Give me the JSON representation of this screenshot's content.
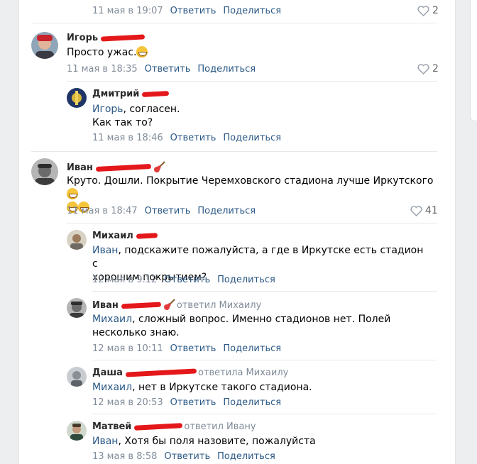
{
  "comments": [
    {
      "date": "11 мая в 19:07",
      "reply": "Ответить",
      "share": "Поделиться",
      "likes": "2"
    },
    {
      "name": "Игорь",
      "text": "Просто ужас.",
      "date": "11 мая в 18:35",
      "reply": "Ответить",
      "share": "Поделиться",
      "likes": "2"
    },
    {
      "name": "Дмитрий",
      "mention": "Игорь",
      "text1": ", согласен.",
      "text2": "Как так то?",
      "date": "11 мая в 18:46",
      "reply": "Ответить",
      "share": "Поделиться"
    },
    {
      "name": "Иван",
      "text": "Круто. Дошли. Покрытие Черемховского стадиона лучше Иркутского",
      "date": "11 мая в 18:47",
      "reply": "Ответить",
      "share": "Поделиться",
      "likes": "41"
    },
    {
      "name": "Михаил",
      "mention": "Иван",
      "text1": ", подскажите пожалуйста, а где в Иркутске есть стадион с",
      "text2": "хорошим покрытием?",
      "date": "12 мая в 9:12",
      "reply": "Ответить",
      "share": "Поделиться"
    },
    {
      "name": "Иван",
      "reply_to": "ответил Михаилу",
      "mention": "Михаил",
      "text1": ", сложный вопрос. Именно стадионов нет. Полей",
      "text2": "несколько знаю.",
      "date": "12 мая в 10:11",
      "reply": "Ответить",
      "share": "Поделиться"
    },
    {
      "name": "Даша",
      "reply_to": "ответила Михаилу",
      "mention": "Михаил",
      "text1": ", нет в Иркутске такого стадиона.",
      "date": "12 мая в 20:53",
      "reply": "Ответить",
      "share": "Поделиться"
    },
    {
      "name": "Матвей",
      "reply_to": "ответил Ивану",
      "mention": "Иван",
      "text1": ", Хотя бы поля назовите, пожалуйста",
      "date": "13 мая в 8:58",
      "reply": "Ответить",
      "share": "Поделиться"
    }
  ]
}
